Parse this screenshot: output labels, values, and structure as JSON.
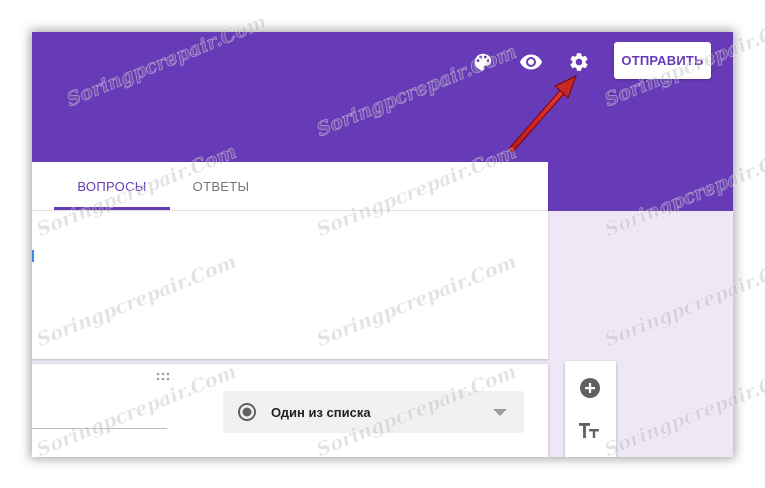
{
  "header": {
    "send_button_label": "ОТПРАВИТЬ",
    "icons": [
      "palette-icon",
      "eye-icon",
      "gear-icon"
    ],
    "color": "#673ab7"
  },
  "tabs": [
    {
      "label": "ВОПРОСЫ",
      "active": true
    },
    {
      "label": "ОТВЕТЫ",
      "active": false
    }
  ],
  "question": {
    "type_label": "Один из списка",
    "type_icon": "radio-button-icon"
  },
  "side_toolbar": {
    "icons": [
      "add-circle-icon",
      "text-format-icon"
    ]
  },
  "annotation": {
    "arrow_color": "#c62828"
  },
  "watermark_text": "Soringpcrepair.Com",
  "colors": {
    "accent": "#673ab7",
    "background": "#ede7f6"
  }
}
